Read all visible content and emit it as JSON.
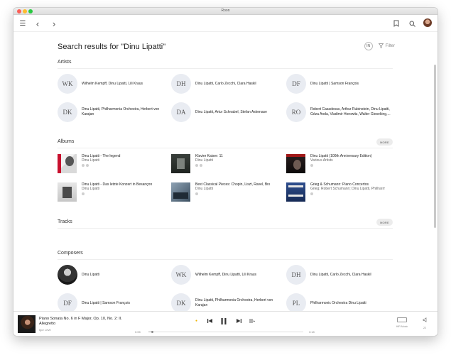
{
  "window": {
    "title": "Roon"
  },
  "toolbar": {
    "menu_icon": "☰",
    "back_icon": "‹",
    "forward_icon": "›",
    "bookmark_icon": "🔖",
    "search_icon": "⌕"
  },
  "search": {
    "title": "Search results for \"Dinu Lipatti\"",
    "in_label": "IN",
    "filter_label": "Filter",
    "filter_icon": "⏷"
  },
  "artists": {
    "heading": "Artists",
    "items": [
      {
        "initials": "WK",
        "name": "Wilhelm Kempff, Dinu Lipatti, Lili Kraus"
      },
      {
        "initials": "DH",
        "name": "Dinu Lipatti, Carlo Zecchi, Clara Haskil"
      },
      {
        "initials": "DF",
        "name": "Dinu Lipatti | Samson François"
      },
      {
        "initials": "DK",
        "name": "Dinu Lipatti, Philharmonia Orchestra, Herbert von Karajan"
      },
      {
        "initials": "DA",
        "name": "Dinu Lipatti, Artur Schnabel, Stefan Askenase"
      },
      {
        "initials": "RO",
        "name": "Robert Casadesus, Arthur Rubinstein, Dinu Lipatti, Géza Anda, Vladimir Horowitz, Walter Gieseking,..."
      }
    ]
  },
  "albums": {
    "heading": "Albums",
    "more_label": "MORE",
    "items": [
      {
        "title": "Dinu Lipatti - The legend",
        "artist": "Dinu Lipatti"
      },
      {
        "title": "Klavier Kaiser: 11",
        "artist": "Dinu Lipatti"
      },
      {
        "title": "Dinu Lipatti (100th Anniversary Edition)",
        "artist": "Various Artists"
      },
      {
        "title": "Dinu Lipatti - Das letzte Konzert in Besançon",
        "artist": "Dinu Lipatti"
      },
      {
        "title": "Best Classical Pieces: Chopin, Liszt, Ravel, Brahms...",
        "artist": "Dinu Lipatti"
      },
      {
        "title": "Grieg & Schumann: Piano Concertos",
        "artist": "Grieg; Robert Schumann; Dinu Lipatti, Philharmonia..."
      }
    ]
  },
  "tracks": {
    "heading": "Tracks",
    "more_label": "MORE"
  },
  "composers": {
    "heading": "Composers",
    "items": [
      {
        "initials": "",
        "name": "Dinu Lipatti"
      },
      {
        "initials": "WK",
        "name": "Wilhelm Kempff, Dinu Lipatti, Lili Kraus"
      },
      {
        "initials": "DH",
        "name": "Dinu Lipatti, Carlo Zecchi, Clara Haskil"
      },
      {
        "initials": "DF",
        "name": "Dinu Lipatti | Samson François"
      },
      {
        "initials": "DK",
        "name": "Dinu Lipatti, Philharmonia Orchestra, Herbert von Karajan"
      },
      {
        "initials": "PL",
        "name": "Philharmonic Orchestra Dinu Lipatti"
      }
    ]
  },
  "player": {
    "title": "Piano Sonata No. 6 in F Major, Op. 10, No. 2: II. Allegretto",
    "artist": "Igor Levit",
    "elapsed": "0:05",
    "duration": "3:18",
    "progress": 0.025,
    "zone_label": "HiFi Music",
    "volume_label": "22",
    "icons": {
      "radio": "●",
      "prev": "⏮",
      "pause": "⏸",
      "next": "⏭",
      "queue": "≡",
      "volume": "◁"
    }
  },
  "colors": {
    "accent": "#f0b400",
    "initials_bg": "#e9ecf2"
  }
}
